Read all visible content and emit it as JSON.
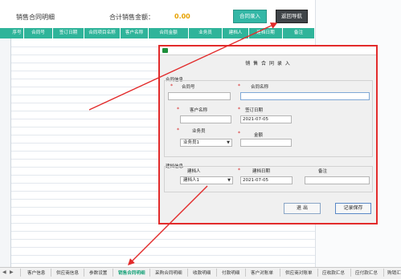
{
  "sheet": {
    "title": "销售合同明细",
    "total_label": "合计销售金额：",
    "total_value": "0.00",
    "entry_button": "合同录入",
    "back_button": "返回导航",
    "columns": [
      "序号",
      "合同号",
      "签订日期",
      "合同项目名称",
      "客户名称",
      "合同金额",
      "业务员",
      "建档人",
      "建档日期",
      "备注"
    ]
  },
  "dialog": {
    "heading": "销 售 合 同 录 入",
    "group_contract": "合同信息",
    "group_archive": "建档信息",
    "fields": {
      "contract_no": {
        "label": "合同号",
        "value": ""
      },
      "contract_name": {
        "label": "合同名称",
        "value": ""
      },
      "customer_name": {
        "label": "客户名称",
        "value": ""
      },
      "sign_date": {
        "label": "签订日期",
        "value": "2021-07-05"
      },
      "salesperson": {
        "label": "业务员",
        "value": "业务员1"
      },
      "amount": {
        "label": "金额",
        "value": ""
      },
      "archiver": {
        "label": "建档人",
        "value": "建档人1"
      },
      "archive_date": {
        "label": "建档日期",
        "value": "2021-07-05"
      },
      "remark": {
        "label": "备注",
        "value": ""
      }
    },
    "exit_button": "退  出",
    "save_button": "记录保存"
  },
  "tabs": [
    "客户信息",
    "供应商信息",
    "参数设置",
    "销售合同明细",
    "采购合同明细",
    "收款明细",
    "付款明细",
    "客户对账单",
    "供应商对账单",
    "应收款汇总",
    "应付款汇总",
    "购销汇"
  ],
  "active_tab": "销售合同明细",
  "colors": {
    "header": "#2fb49a",
    "entry_button": "#34b7a6",
    "back_button": "#3f4448",
    "highlight": "#e22b2b",
    "total": "#e6a100"
  }
}
